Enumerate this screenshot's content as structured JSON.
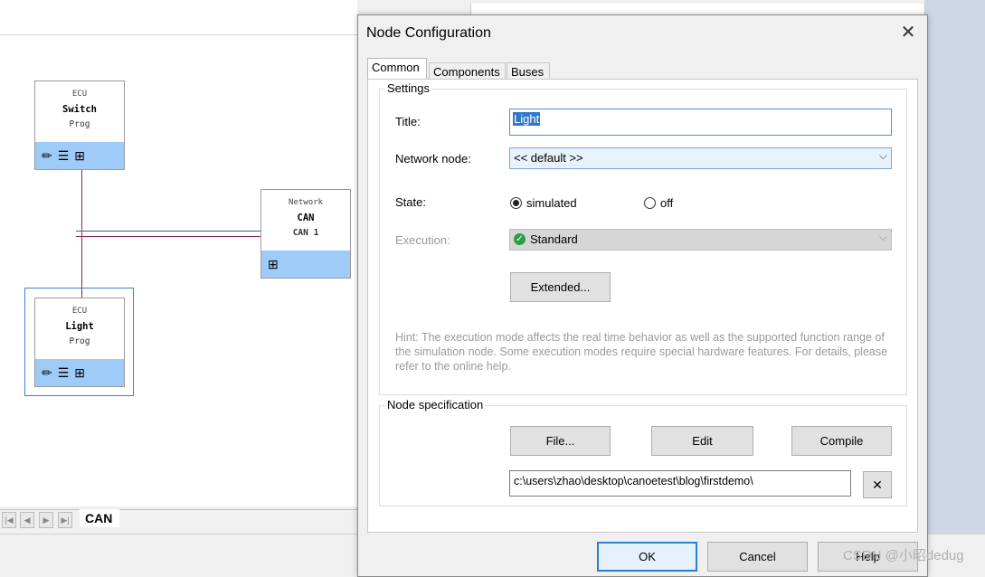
{
  "background": {
    "nodes": [
      {
        "kind": "ECU",
        "name": "Switch",
        "sub": "Prog"
      },
      {
        "kind": "Network",
        "name": "CAN",
        "sub": "CAN 1"
      },
      {
        "kind": "ECU",
        "name": "Light",
        "sub": "Prog"
      }
    ],
    "bottom_tab": "CAN",
    "nav_icons": [
      "first-icon",
      "prev-icon",
      "next-icon",
      "last-icon"
    ],
    "colors": {
      "node_iconbar": "#9ecbf8",
      "connection_line": "#8c2550",
      "selection": "#3c7fd6"
    }
  },
  "dialog": {
    "title": "Node Configuration",
    "close_glyph": "✕",
    "tabs": [
      {
        "label": "Common",
        "active": true
      },
      {
        "label": "Components",
        "active": false
      },
      {
        "label": "Buses",
        "active": false
      }
    ],
    "settings": {
      "group_label": "Settings",
      "title_label": "Title:",
      "title_value": "Light",
      "network_node_label": "Network node:",
      "network_node_value": "<< default >>",
      "state_label": "State:",
      "state_options": [
        {
          "label": "simulated",
          "checked": true
        },
        {
          "label": "off",
          "checked": false
        }
      ],
      "execution_label": "Execution:",
      "execution_value": "Standard",
      "extended_button": "Extended...",
      "hint": "Hint: The execution mode affects the real time behavior as well as the supported function range of the simulation node. Some execution modes require special hardware features. For details, please refer to the online help."
    },
    "node_spec": {
      "group_label": "Node specification",
      "file_button": "File...",
      "edit_button": "Edit",
      "compile_button": "Compile",
      "path_value": "c:\\users\\zhao\\desktop\\canoetest\\blog\\firstdemo\\",
      "clear_glyph": "✕"
    },
    "buttons": {
      "ok": "OK",
      "cancel": "Cancel",
      "help": "Help"
    }
  },
  "watermark": "CSDN @小昭dedug"
}
